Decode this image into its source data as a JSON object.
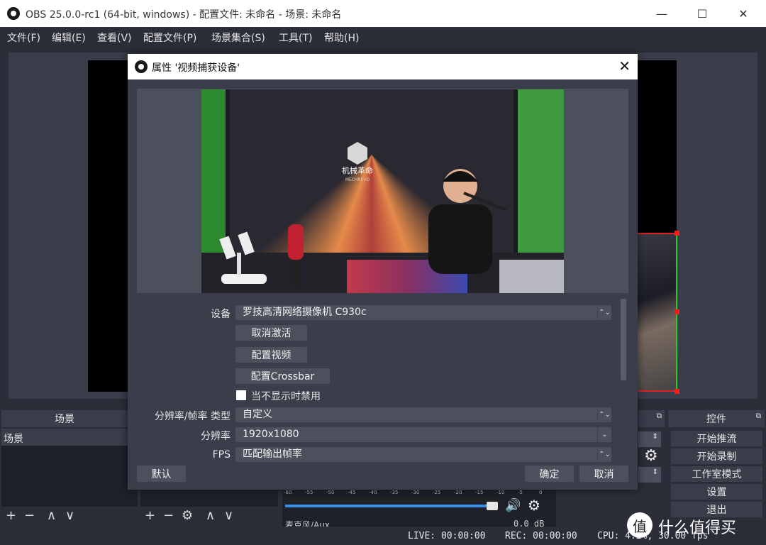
{
  "window": {
    "title": "OBS 25.0.0-rc1 (64-bit, windows) - 配置文件: 未命名 - 场景: 未命名",
    "minimize": "—",
    "maximize": "☐",
    "close": "✕"
  },
  "menu": [
    "文件(F)",
    "编辑(E)",
    "查看(V)",
    "配置文件(P)",
    "场景集合(S)",
    "工具(T)",
    "帮助(H)"
  ],
  "docks": {
    "scenes_header": "场景",
    "scene_item": "场景",
    "controls_header": "控件",
    "controls": [
      "开始推流",
      "开始录制",
      "工作室模式",
      "设置",
      "退出"
    ]
  },
  "toolbar_glyphs": {
    "add": "+",
    "remove": "−",
    "up": "∧",
    "down": "∨",
    "gear": "⚙"
  },
  "mixer": {
    "source_label": "麦克风/Aux",
    "level": "0.0 dB",
    "volume_fraction": 0.98,
    "meter_ticks": [
      "-60",
      "-55",
      "-50",
      "-45",
      "-40",
      "-35",
      "-30",
      "-25",
      "-20",
      "-15",
      "-10",
      "-5",
      "0"
    ]
  },
  "status": {
    "live": "LIVE: 00:00:00",
    "rec": "REC: 00:00:00",
    "cpu": "CPU: 4.2%, 30.00 fps"
  },
  "dialog": {
    "title": "属性 '视频捕获设备'",
    "close": "✕",
    "device_label": "设备",
    "device_value": "罗技高清网络摄像机 C930c",
    "btn_deactivate": "取消激活",
    "btn_config_video": "配置视频",
    "btn_config_crossbar": "配置Crossbar",
    "checkbox_label": "当不显示时禁用",
    "checkbox_checked": false,
    "res_type_label": "分辨率/帧率 类型",
    "res_type_value": "自定义",
    "resolution_label": "分辨率",
    "resolution_value": "1920x1080",
    "fps_label": "FPS",
    "fps_value": "匹配输出帧率",
    "btn_default": "默认",
    "btn_ok": "确定",
    "btn_cancel": "取消"
  },
  "camera_preview": {
    "logo_text_cn": "机械革命",
    "logo_text_en": "MECHREVO"
  },
  "watermark": {
    "text": "什么值得买",
    "symbol": "值"
  },
  "colors": {
    "bg": "#2b2e38",
    "panel": "#3a3d4a",
    "input": "#4c4f5c",
    "selection_red": "#ff1a1a",
    "selection_green": "#22cc22",
    "volume_blue": "#3a8ee6"
  }
}
